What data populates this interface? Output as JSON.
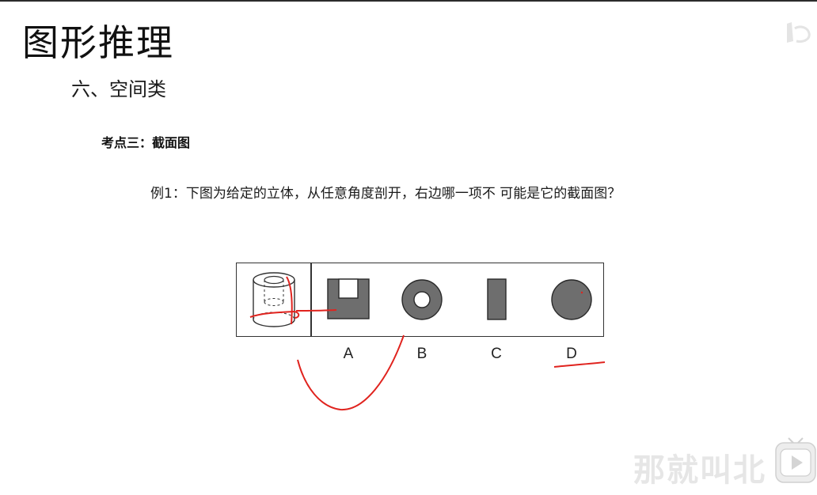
{
  "slide": {
    "title": "图形推理",
    "section": "六、空间类",
    "topic": "考点三：截面图",
    "question": "例1：下图为给定的立体，从任意角度剖开，右边哪一项不 可能是它的截面图？"
  },
  "options": {
    "a_label": "A",
    "b_label": "B",
    "c_label": "C",
    "d_label": "D"
  },
  "icons": {
    "solid": "hollow-cylinder-icon",
    "option_a": "square-with-notch-icon",
    "option_b": "ring-icon",
    "option_c": "rectangle-icon",
    "option_d": "filled-circle-icon",
    "player": "play-button-icon"
  },
  "watermarks": {
    "bottom": "那就叫北"
  },
  "colors": {
    "shape_fill": "#6e6e6e",
    "shape_stroke": "#2a2a2a",
    "annotation": "#e0231e",
    "watermark": "#e6e6e6"
  }
}
